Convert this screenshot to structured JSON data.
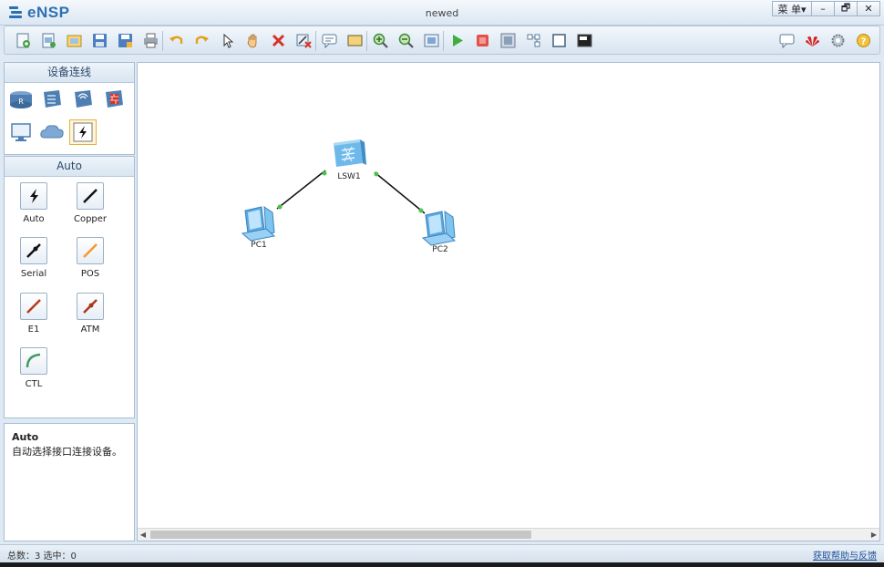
{
  "app": {
    "name": "eNSP",
    "window_title": "newed"
  },
  "window_controls": {
    "menu": "菜 单▾",
    "minimize": "–",
    "restore": "🗗",
    "close": "✕"
  },
  "toolbar": {
    "items": [
      "new-topology-icon",
      "new-example-icon",
      "open-icon",
      "save-icon",
      "save-as-icon",
      "print-icon",
      "undo-icon",
      "redo-icon",
      "select-pointer-icon",
      "pan-hand-icon",
      "delete-icon",
      "delete-link-icon",
      "text-note-icon",
      "rectangle-icon",
      "zoom-in-icon",
      "zoom-out-icon",
      "fit-view-icon",
      "start-device-icon",
      "stop-device-icon",
      "capture-data-icon",
      "topology-icon",
      "show-interface-icon",
      "console-icon",
      "chat-icon",
      "huawei-logo-icon",
      "settings-icon",
      "help-icon"
    ]
  },
  "left_panel": {
    "category_title": "设备连线",
    "device_categories": [
      "router-icon",
      "switch-icon",
      "wireless-icon",
      "firewall-icon",
      "pc-terminal-icon",
      "cloud-icon",
      "connection-icon"
    ],
    "cable_title": "Auto",
    "cables": [
      {
        "label": "Auto",
        "color": "#111111"
      },
      {
        "label": "Copper",
        "color": "#111111"
      },
      {
        "label": "Serial",
        "color": "#111111"
      },
      {
        "label": "POS",
        "color": "#f29a2e"
      },
      {
        "label": "E1",
        "color": "#b8381b"
      },
      {
        "label": "ATM",
        "color": "#a8381b"
      },
      {
        "label": "CTL",
        "color": "#3f9a66"
      }
    ],
    "description": {
      "title": "Auto",
      "text": "自动选择接口连接设备。"
    }
  },
  "topology": {
    "nodes": [
      {
        "id": "LSW1",
        "label": "LSW1",
        "type": "switch"
      },
      {
        "id": "PC1",
        "label": "PC1",
        "type": "pc"
      },
      {
        "id": "PC2",
        "label": "PC2",
        "type": "pc"
      }
    ],
    "links": [
      {
        "from": "LSW1",
        "to": "PC1",
        "status_color": "#4cc24c"
      },
      {
        "from": "LSW1",
        "to": "PC2",
        "status_color": "#4cc24c"
      }
    ]
  },
  "status_bar": {
    "summary": "总数：3  选中：0",
    "help_link": "获取帮助与反馈"
  }
}
